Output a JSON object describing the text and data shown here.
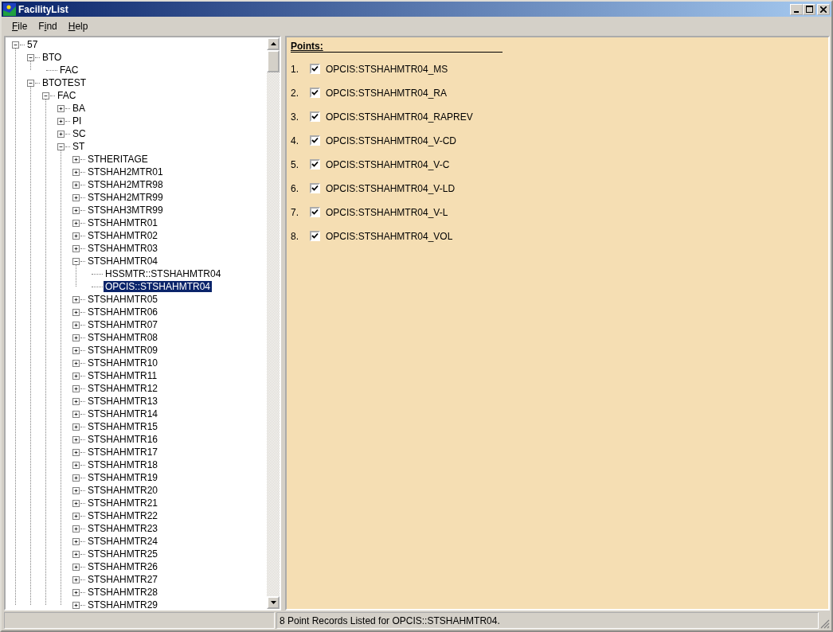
{
  "window": {
    "title": "FacilityList"
  },
  "menu": [
    {
      "accelerator": "F",
      "rest": "ile"
    },
    {
      "lead": "F",
      "accelerator": "i",
      "rest": "nd"
    },
    {
      "accelerator": "H",
      "rest": "elp"
    }
  ],
  "tree": [
    {
      "label": "57",
      "kind": "branch",
      "expanded": true,
      "selected": false,
      "children": [
        {
          "label": "BTO",
          "kind": "branch",
          "expanded": true,
          "selected": false,
          "children": [
            {
              "label": "FAC",
              "kind": "leaf",
              "selected": false
            }
          ]
        },
        {
          "label": "BTOTEST",
          "kind": "branch",
          "expanded": true,
          "selected": false,
          "children": [
            {
              "label": "FAC",
              "kind": "branch",
              "expanded": true,
              "selected": false,
              "children": [
                {
                  "label": "BA",
                  "kind": "branch",
                  "expanded": false,
                  "selected": false
                },
                {
                  "label": "PI",
                  "kind": "branch",
                  "expanded": false,
                  "selected": false
                },
                {
                  "label": "SC",
                  "kind": "branch",
                  "expanded": false,
                  "selected": false
                },
                {
                  "label": "ST",
                  "kind": "branch",
                  "expanded": true,
                  "selected": false,
                  "children": [
                    {
                      "label": "STHERITAGE",
                      "kind": "branch",
                      "expanded": false,
                      "selected": false
                    },
                    {
                      "label": "STSHAH2MTR01",
                      "kind": "branch",
                      "expanded": false,
                      "selected": false
                    },
                    {
                      "label": "STSHAH2MTR98",
                      "kind": "branch",
                      "expanded": false,
                      "selected": false
                    },
                    {
                      "label": "STSHAH2MTR99",
                      "kind": "branch",
                      "expanded": false,
                      "selected": false
                    },
                    {
                      "label": "STSHAH3MTR99",
                      "kind": "branch",
                      "expanded": false,
                      "selected": false
                    },
                    {
                      "label": "STSHAHMTR01",
                      "kind": "branch",
                      "expanded": false,
                      "selected": false
                    },
                    {
                      "label": "STSHAHMTR02",
                      "kind": "branch",
                      "expanded": false,
                      "selected": false
                    },
                    {
                      "label": "STSHAHMTR03",
                      "kind": "branch",
                      "expanded": false,
                      "selected": false
                    },
                    {
                      "label": "STSHAHMTR04",
                      "kind": "branch",
                      "expanded": true,
                      "selected": false,
                      "children": [
                        {
                          "label": "HSSMTR::STSHAHMTR04",
                          "kind": "leaf",
                          "selected": false
                        },
                        {
                          "label": "OPCIS::STSHAHMTR04",
                          "kind": "leaf",
                          "selected": true
                        }
                      ]
                    },
                    {
                      "label": "STSHAHMTR05",
                      "kind": "branch",
                      "expanded": false,
                      "selected": false
                    },
                    {
                      "label": "STSHAHMTR06",
                      "kind": "branch",
                      "expanded": false,
                      "selected": false
                    },
                    {
                      "label": "STSHAHMTR07",
                      "kind": "branch",
                      "expanded": false,
                      "selected": false
                    },
                    {
                      "label": "STSHAHMTR08",
                      "kind": "branch",
                      "expanded": false,
                      "selected": false
                    },
                    {
                      "label": "STSHAHMTR09",
                      "kind": "branch",
                      "expanded": false,
                      "selected": false
                    },
                    {
                      "label": "STSHAHMTR10",
                      "kind": "branch",
                      "expanded": false,
                      "selected": false
                    },
                    {
                      "label": "STSHAHMTR11",
                      "kind": "branch",
                      "expanded": false,
                      "selected": false
                    },
                    {
                      "label": "STSHAHMTR12",
                      "kind": "branch",
                      "expanded": false,
                      "selected": false
                    },
                    {
                      "label": "STSHAHMTR13",
                      "kind": "branch",
                      "expanded": false,
                      "selected": false
                    },
                    {
                      "label": "STSHAHMTR14",
                      "kind": "branch",
                      "expanded": false,
                      "selected": false
                    },
                    {
                      "label": "STSHAHMTR15",
                      "kind": "branch",
                      "expanded": false,
                      "selected": false
                    },
                    {
                      "label": "STSHAHMTR16",
                      "kind": "branch",
                      "expanded": false,
                      "selected": false
                    },
                    {
                      "label": "STSHAHMTR17",
                      "kind": "branch",
                      "expanded": false,
                      "selected": false
                    },
                    {
                      "label": "STSHAHMTR18",
                      "kind": "branch",
                      "expanded": false,
                      "selected": false
                    },
                    {
                      "label": "STSHAHMTR19",
                      "kind": "branch",
                      "expanded": false,
                      "selected": false
                    },
                    {
                      "label": "STSHAHMTR20",
                      "kind": "branch",
                      "expanded": false,
                      "selected": false
                    },
                    {
                      "label": "STSHAHMTR21",
                      "kind": "branch",
                      "expanded": false,
                      "selected": false
                    },
                    {
                      "label": "STSHAHMTR22",
                      "kind": "branch",
                      "expanded": false,
                      "selected": false
                    },
                    {
                      "label": "STSHAHMTR23",
                      "kind": "branch",
                      "expanded": false,
                      "selected": false
                    },
                    {
                      "label": "STSHAHMTR24",
                      "kind": "branch",
                      "expanded": false,
                      "selected": false
                    },
                    {
                      "label": "STSHAHMTR25",
                      "kind": "branch",
                      "expanded": false,
                      "selected": false
                    },
                    {
                      "label": "STSHAHMTR26",
                      "kind": "branch",
                      "expanded": false,
                      "selected": false
                    },
                    {
                      "label": "STSHAHMTR27",
                      "kind": "branch",
                      "expanded": false,
                      "selected": false
                    },
                    {
                      "label": "STSHAHMTR28",
                      "kind": "branch",
                      "expanded": false,
                      "selected": false
                    },
                    {
                      "label": "STSHAHMTR29",
                      "kind": "branch",
                      "expanded": false,
                      "selected": false
                    }
                  ]
                }
              ]
            }
          ]
        }
      ]
    }
  ],
  "points": {
    "heading": "Points:",
    "items": [
      {
        "number": "1.",
        "checked": true,
        "label": "OPCIS:STSHAHMTR04_MS"
      },
      {
        "number": "2.",
        "checked": true,
        "label": "OPCIS:STSHAHMTR04_RA"
      },
      {
        "number": "3.",
        "checked": true,
        "label": "OPCIS:STSHAHMTR04_RAPREV"
      },
      {
        "number": "4.",
        "checked": true,
        "label": "OPCIS:STSHAHMTR04_V-CD"
      },
      {
        "number": "5.",
        "checked": true,
        "label": "OPCIS:STSHAHMTR04_V-C"
      },
      {
        "number": "6.",
        "checked": true,
        "label": "OPCIS:STSHAHMTR04_V-LD"
      },
      {
        "number": "7.",
        "checked": true,
        "label": "OPCIS:STSHAHMTR04_V-L"
      },
      {
        "number": "8.",
        "checked": true,
        "label": "OPCIS:STSHAHMTR04_VOL"
      }
    ]
  },
  "status_bar": {
    "message": "8 Point Records Listed for OPCIS::STSHAHMTR04."
  }
}
